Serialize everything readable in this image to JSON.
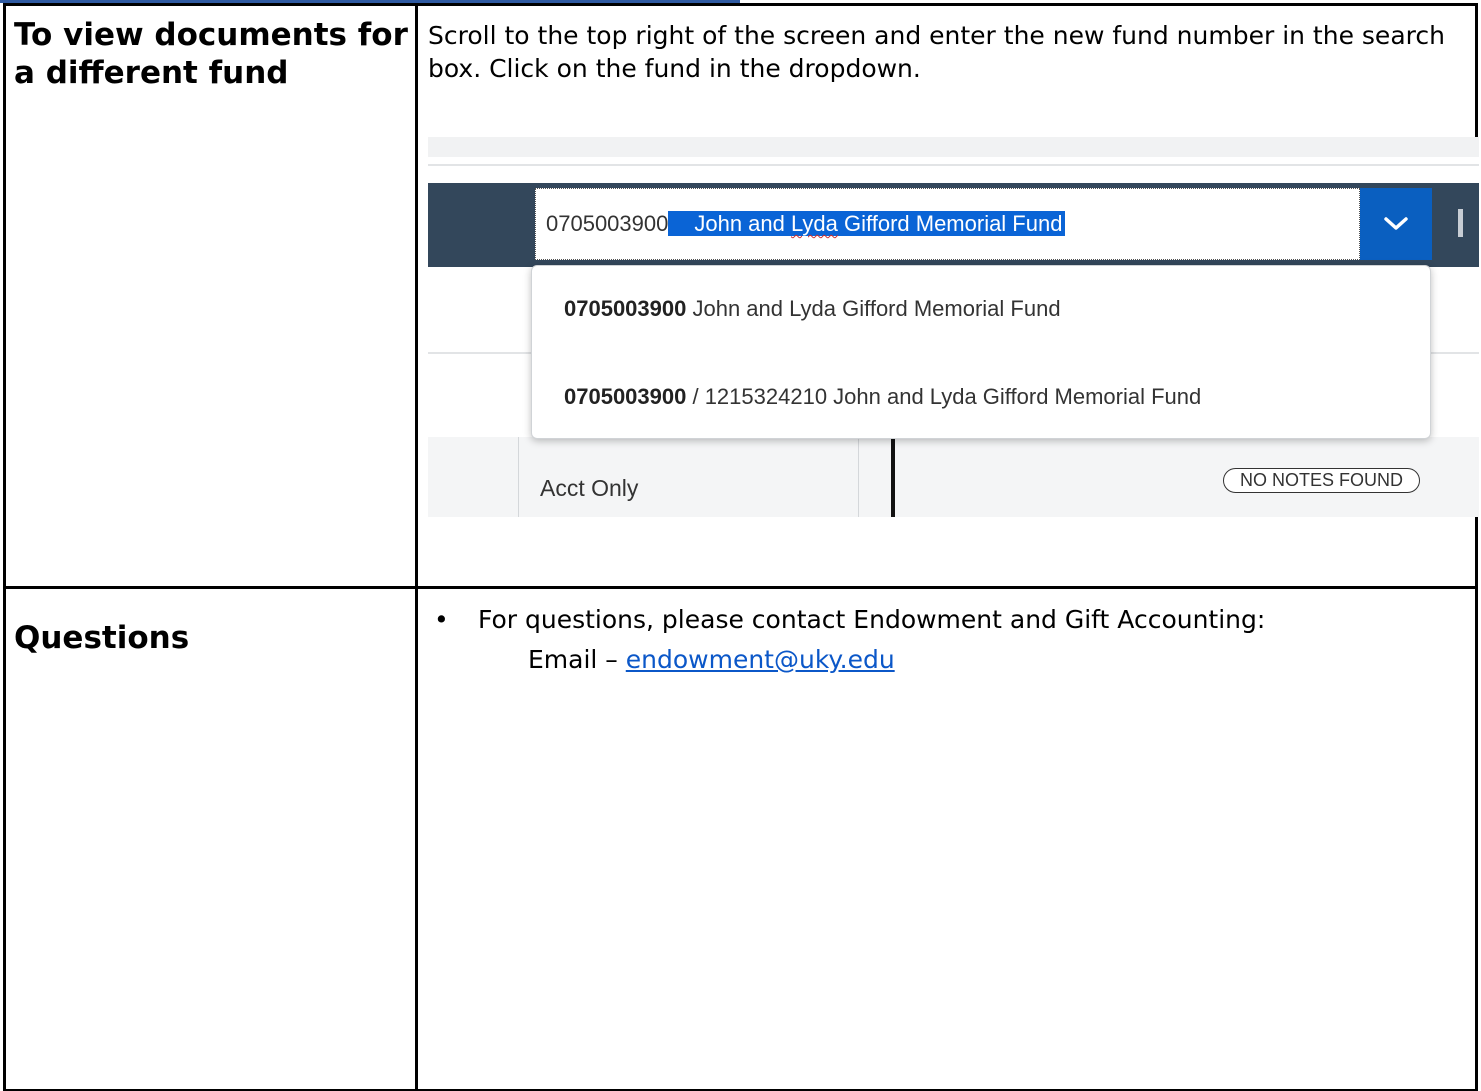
{
  "rows": [
    {
      "label": "To view documents for a different fund",
      "instruction": "Scroll to the top right of the screen and enter the new fund number in the search box. Click on the fund in the dropdown."
    },
    {
      "label": "Questions",
      "bullet": "For questions, please contact Endowment and Gift Accounting:",
      "email_prefix": "Email – ",
      "email_link": "endowment@uky.edu"
    }
  ],
  "screenshot": {
    "search_value_number": "0705003900",
    "search_value_selected_pre": "John and ",
    "search_value_selected_squiggle": "Lyda",
    "search_value_selected_post": " Gifford Memorial Fund",
    "dropdown_items": [
      {
        "bold": "0705003900",
        "rest": " John and Lyda Gifford Memorial Fund"
      },
      {
        "bold": "0705003900",
        "rest": " / 1215324210 John and Lyda Gifford Memorial Fund"
      }
    ],
    "table_cell_text": "Acct Only",
    "notes_badge": "NO NOTES FOUND",
    "dropdown_icon": "chevron-down-icon"
  },
  "colors": {
    "link": "#0b57c8",
    "header_bar": "#33475b",
    "dropdown_button": "#0a5fc0",
    "selection": "#0a64d6"
  }
}
